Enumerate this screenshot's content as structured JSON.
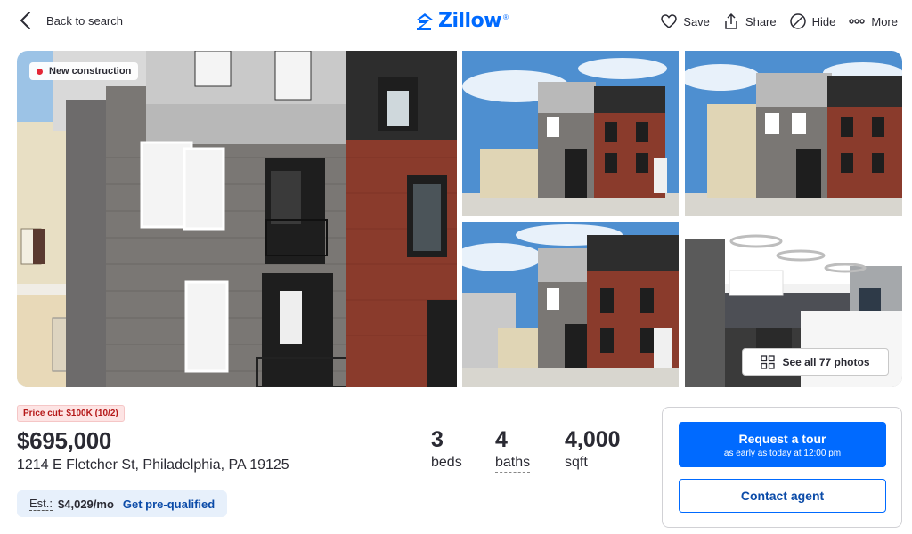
{
  "header": {
    "back_label": "Back to search",
    "logo_text": "Zillow",
    "logo_mark": "®",
    "actions": {
      "save": "Save",
      "share": "Share",
      "hide": "Hide",
      "more": "More"
    }
  },
  "gallery": {
    "badge": "New construction",
    "see_all_label": "See all 77 photos",
    "photos": [
      "front-exterior",
      "exterior-angle-left",
      "exterior-angle-right",
      "exterior-wide",
      "kitchen-interior"
    ]
  },
  "listing": {
    "price_cut": "Price cut: $100K (10/2)",
    "price": "$695,000",
    "address": "1214 E Fletcher St, Philadelphia, PA 19125",
    "stats": {
      "beds_value": "3",
      "beds_label": "beds",
      "baths_value": "4",
      "baths_label": "baths",
      "sqft_value": "4,000",
      "sqft_label": "sqft"
    },
    "estimate": {
      "label": "Est.:",
      "value": "$4,029/mo",
      "link": "Get pre-qualified"
    }
  },
  "contact": {
    "tour_label": "Request a tour",
    "tour_sub": "as early as today at 12:00 pm",
    "agent_label": "Contact agent"
  },
  "colors": {
    "brand": "#006aff",
    "price_cut_text": "#b51818",
    "price_cut_bg": "#fde4e4",
    "estimate_bg": "#e7f0fb"
  },
  "icons": [
    "chevron-left-icon",
    "zillow-logo-icon",
    "heart-icon",
    "share-icon",
    "hide-icon",
    "more-icon",
    "grid-icon"
  ]
}
